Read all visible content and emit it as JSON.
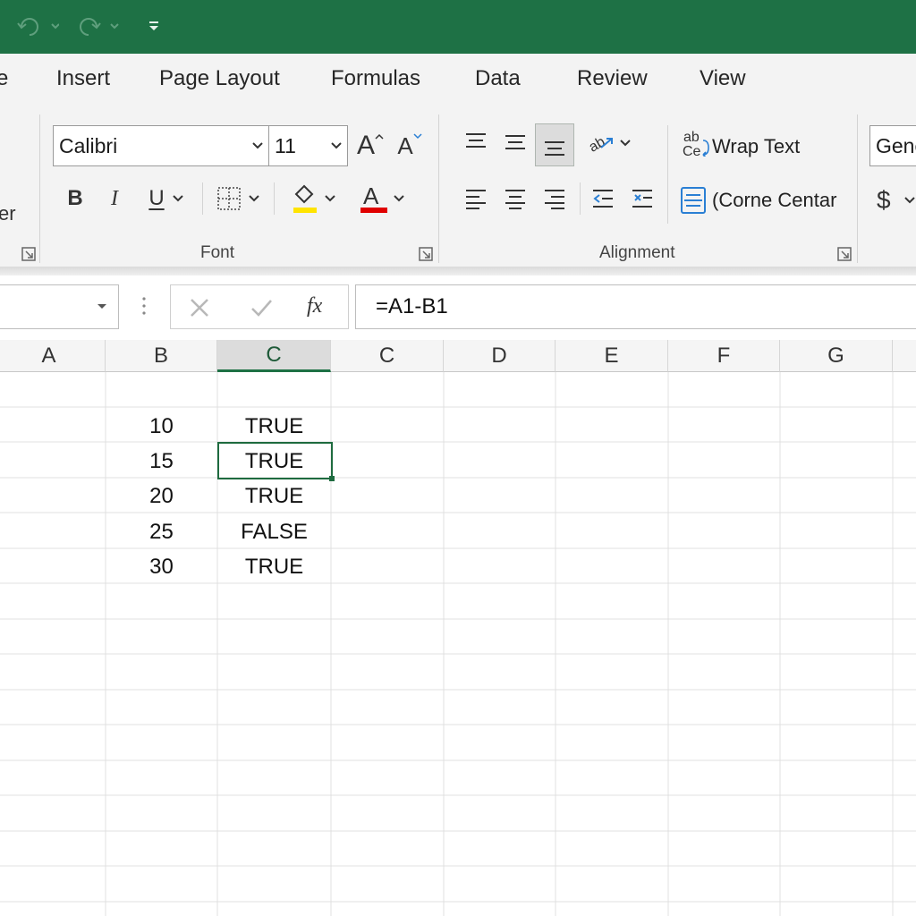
{
  "ribbon_tabs": [
    {
      "label": "e"
    },
    {
      "label": "Insert"
    },
    {
      "label": "Page Layout"
    },
    {
      "label": "Formulas"
    },
    {
      "label": "Data"
    },
    {
      "label": "Review"
    },
    {
      "label": "View"
    }
  ],
  "font_group": {
    "font_name": "Calibri",
    "font_size": "11",
    "label": "Font",
    "bold": "B",
    "italic": "I",
    "underline": "U",
    "grow_glyph": "A",
    "shrink_glyph": "A",
    "font_color_glyph": "A"
  },
  "alignment_group": {
    "wrap_text_icon": "ab",
    "wrap_text_icon_2": "Ce",
    "wrap_text": "Wrap Text",
    "merge_center": "(Corne Centar",
    "label": "Alignment"
  },
  "number_group": {
    "format": "Genc",
    "currency_symbol": "$"
  },
  "clipboard_group": {
    "partial_label": "er"
  },
  "formula_bar": {
    "fx": "fx",
    "formula": "=A1-B1"
  },
  "columns": [
    "A",
    "B",
    "C",
    "C",
    "D",
    "E",
    "F",
    "G"
  ],
  "active_column_index": 2,
  "cells": [
    {
      "b": "10",
      "c": "TRUE"
    },
    {
      "b": "15",
      "c": "TRUE"
    },
    {
      "b": "20",
      "c": "TRUE"
    },
    {
      "b": "25",
      "c": "FALSE"
    },
    {
      "b": "30",
      "c": "TRUE"
    }
  ],
  "colors": {
    "title_bar": "#1e7145",
    "highlight": "#ffe400",
    "font_color": "#e00000",
    "selection": "#1e6b3f"
  }
}
